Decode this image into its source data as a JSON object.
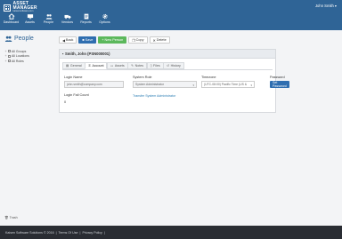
{
  "header": {
    "logo_main": "ASSET MANAGER",
    "logo_sub": "kaisensoftware.com",
    "user_menu": "John Smith"
  },
  "nav": [
    {
      "label": "Dashboard",
      "icon": "home-icon"
    },
    {
      "label": "Assets",
      "icon": "assets-icon"
    },
    {
      "label": "People",
      "icon": "people-icon"
    },
    {
      "label": "Vendors",
      "icon": "vendors-icon"
    },
    {
      "label": "Reports",
      "icon": "reports-icon"
    },
    {
      "label": "Options",
      "icon": "gear-icon"
    }
  ],
  "sidebar": {
    "title": "People",
    "items": [
      "All Groups",
      "All Locations",
      "All Roles"
    ],
    "trash_label": "Trash"
  },
  "toolbar": {
    "back": "Back",
    "save": "Save",
    "new_person": "New Person",
    "copy": "Copy",
    "delete": "Delete"
  },
  "record": {
    "title": "Smith, John (PSN000001)",
    "tabs": [
      "General",
      "Account",
      "Assets",
      "Notes",
      "Files",
      "History"
    ],
    "active_tab": "Account",
    "login_name_label": "Login Name",
    "login_name_value": "john.smith@company.com",
    "system_role_label": "System Role",
    "system_role_value": "System Administrator",
    "timezone_label": "Timezone",
    "timezone_value": "(UTC-08:00) Pacific Time (US &",
    "password_label": "Password",
    "set_password": "Set Password",
    "login_fail_label": "Login Fail Count",
    "login_fail_value": "0",
    "transfer_link": "Transfer System Administrator"
  },
  "footer": {
    "copyright": "Kaisen Software Solutions © 2016",
    "terms": "Terms Of Use",
    "privacy": "Privacy Policy"
  },
  "colors": {
    "header": "#2f6496",
    "primary": "#2f6eb0",
    "success": "#5cb85c",
    "footer": "#2a2d33"
  }
}
